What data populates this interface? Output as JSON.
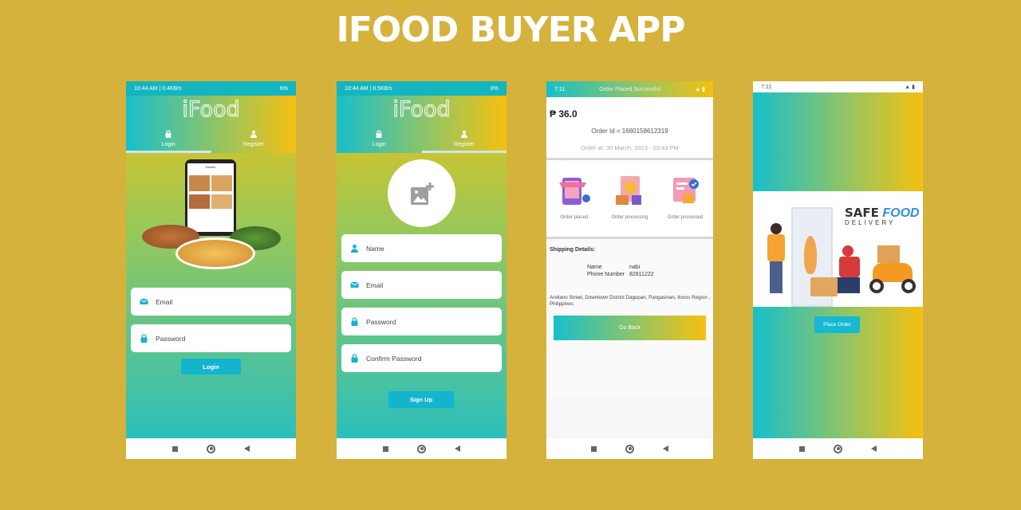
{
  "title": "IFOOD BUYER APP",
  "colors": {
    "background": "#d4b23c",
    "accent": "#14b4cf",
    "gradient_top": "#f3c013",
    "gradient_bottom": "#20bfc7"
  },
  "login_screen": {
    "status_left": "10:44 AM | 0.4KB/s",
    "status_right": "6%",
    "logo": "iFood",
    "tabs": [
      {
        "label": "Login",
        "icon": "lock-icon"
      },
      {
        "label": "Register",
        "icon": "person-icon"
      }
    ],
    "phone_mock_title": "Search",
    "email_placeholder": "Email",
    "password_placeholder": "Password",
    "login_button": "Login"
  },
  "register_screen": {
    "status_left": "10:44 AM | 8.5KB/s",
    "status_right": "6%",
    "logo": "iFood",
    "tabs": [
      {
        "label": "Login",
        "icon": "lock-icon"
      },
      {
        "label": "Register",
        "icon": "person-icon"
      }
    ],
    "name_placeholder": "Name",
    "email_placeholder": "Email",
    "password_placeholder": "Password",
    "confirm_password_placeholder": "Confirm Password",
    "signup_button": "Sign Up"
  },
  "order_screen": {
    "status_left": "7:11",
    "status_center": "Order Placed Successful",
    "price": "₱ 36.0",
    "order_id": "Order Id = 1680158612319",
    "order_at": "Order at: 30 March, 2023 - 02:43 PM",
    "steps": [
      "Order placed",
      "Order processing",
      "Order processed"
    ],
    "shipping_title": "Shipping Details:",
    "name_label": "Name",
    "name_value": "nabi",
    "phone_label": "Phone Number",
    "phone_value": "82811222",
    "address": "Arellano Street, Downtown District Dagupan, Pangasinan, Ilocos Region , Philippines",
    "go_back_button": "Go Back"
  },
  "delivery_screen": {
    "status_left": "7:11",
    "banner_line1a": "SAFE",
    "banner_line1b": "FOOD",
    "banner_line2": "DELIVERY",
    "place_order_button": "Place Order"
  }
}
